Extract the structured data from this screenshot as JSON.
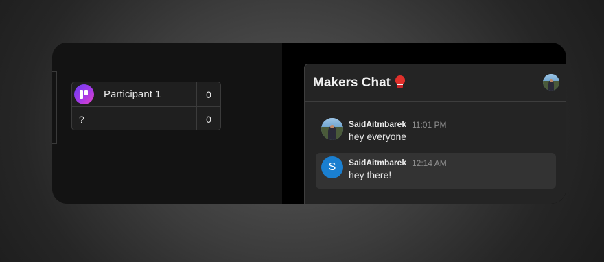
{
  "bracket": {
    "match": {
      "participants": [
        {
          "name": "Participant 1",
          "score": "0",
          "logo": "purple-gradient-logo"
        },
        {
          "name": "?",
          "score": "0"
        }
      ]
    }
  },
  "chat": {
    "title": "Makers Chat",
    "title_emoji": "boxing-glove-icon",
    "messages": [
      {
        "user": "SaidAitmbarek",
        "time": "11:01 PM",
        "text": "hey everyone",
        "avatar": "photo"
      },
      {
        "user": "SaidAitmbarek",
        "time": "12:14 AM",
        "text": "hey there!",
        "avatar": "S",
        "avatar_color": "#1a7fd0",
        "highlighted": true
      }
    ]
  }
}
